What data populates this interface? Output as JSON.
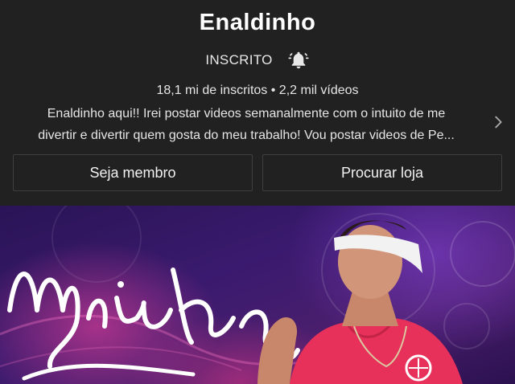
{
  "channel": {
    "name": "Enaldinho",
    "subscribe_status": "INSCRITO",
    "stats": "18,1 mi de inscritos • 2,2 mil vídeos",
    "description_line1": "Enaldinho aqui!! Irei postar videos semanalmente com o intuito de me",
    "description_line2": "divertir e divertir quem gosta do meu trabalho! Vou postar videos de Pe..."
  },
  "actions": {
    "member_label": "Seja membro",
    "store_label": "Procurar loja"
  },
  "icons": {
    "notification": "bell-icon",
    "expand": "chevron-right-icon"
  },
  "colors": {
    "background": "#212121",
    "button_border": "#3f3f3f",
    "text": "#ffffff",
    "banner_shirt": "#e8315a"
  }
}
